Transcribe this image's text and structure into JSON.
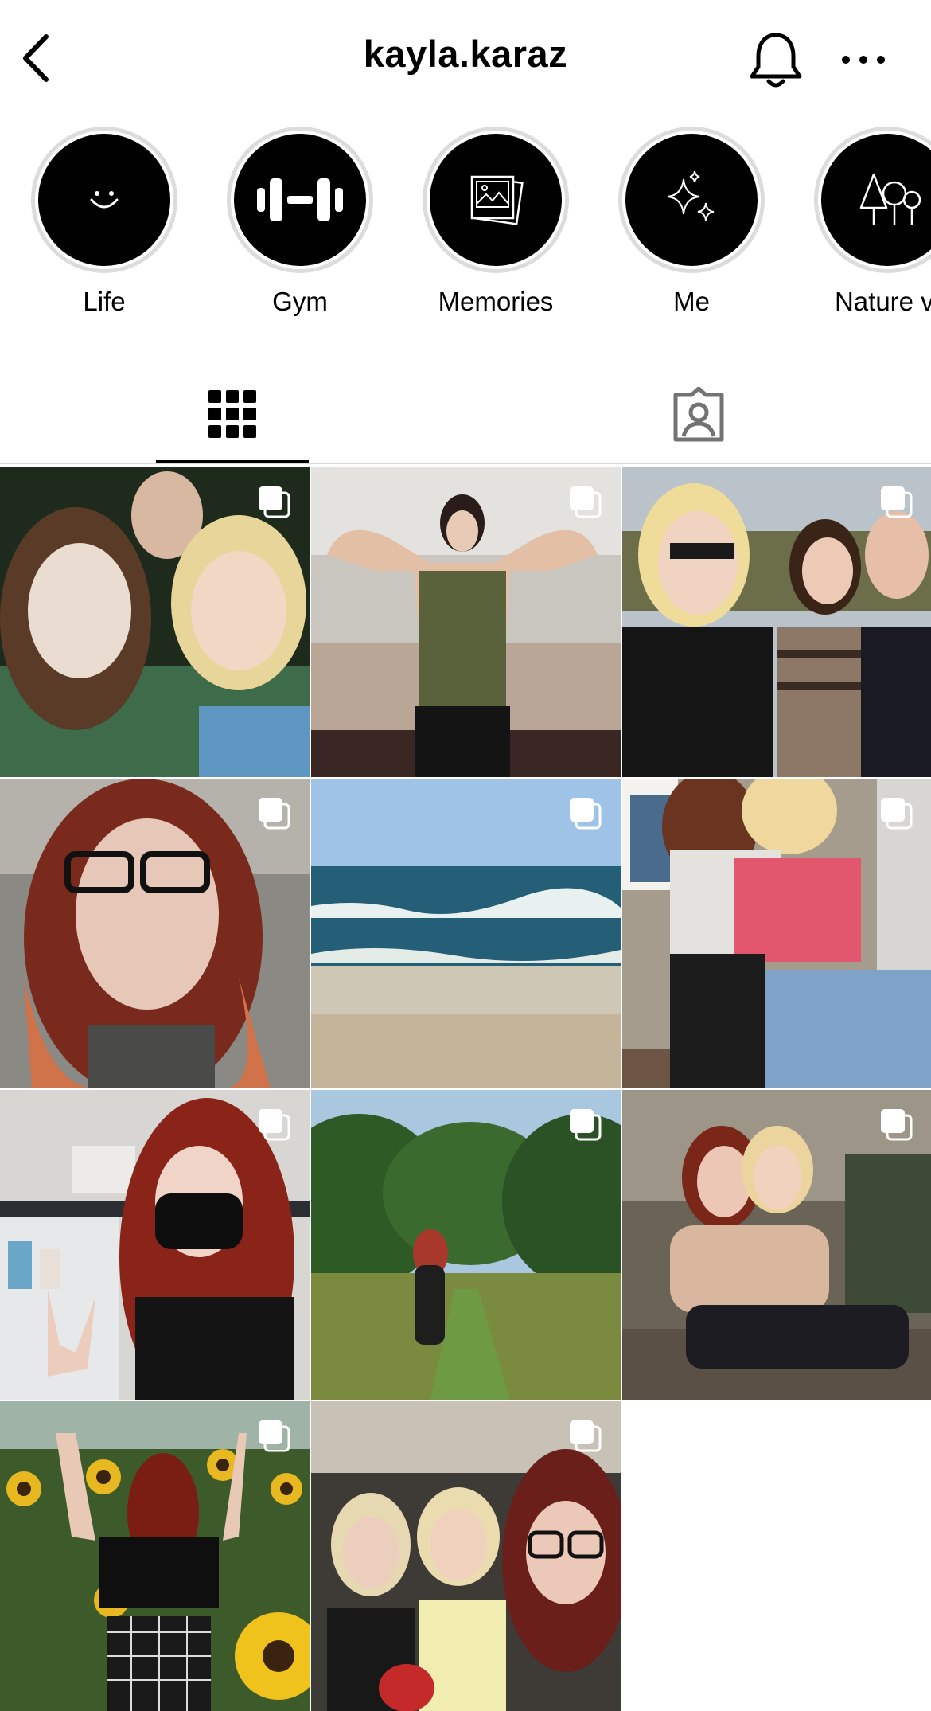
{
  "header": {
    "username": "kayla.karaz",
    "back_icon": "chevron-left-icon",
    "bell_icon": "bell-icon",
    "more_icon": "more-horizontal-icon"
  },
  "highlights": [
    {
      "label": "Life",
      "icon": "smiley-icon"
    },
    {
      "label": "Gym",
      "icon": "dumbbell-icon"
    },
    {
      "label": "Memories",
      "icon": "photos-icon"
    },
    {
      "label": "Me",
      "icon": "sparkles-icon"
    },
    {
      "label": "Nature vi",
      "icon": "trees-icon"
    }
  ],
  "tabs": [
    {
      "name": "posts-grid",
      "icon": "grid-icon",
      "active": true
    },
    {
      "name": "tagged",
      "icon": "tagged-person-icon",
      "active": false
    }
  ],
  "posts": [
    {
      "subject": "three friends selfie",
      "multi": true
    },
    {
      "subject": "gym flex mirror",
      "multi": true
    },
    {
      "subject": "three friends outdoor",
      "multi": true
    },
    {
      "subject": "car selfie glasses",
      "multi": true
    },
    {
      "subject": "ocean waves",
      "multi": true
    },
    {
      "subject": "hug by house",
      "multi": true
    },
    {
      "subject": "masked peace sign",
      "multi": true
    },
    {
      "subject": "walking in field",
      "multi": true
    },
    {
      "subject": "two friends on rocks",
      "multi": true
    },
    {
      "subject": "sunflowers field",
      "multi": true
    },
    {
      "subject": "three friends in car",
      "multi": true
    }
  ],
  "colors": {
    "active_tab": "#000000",
    "inactive_tab": "#8e8e8e",
    "ring": "#dcdcdc"
  }
}
